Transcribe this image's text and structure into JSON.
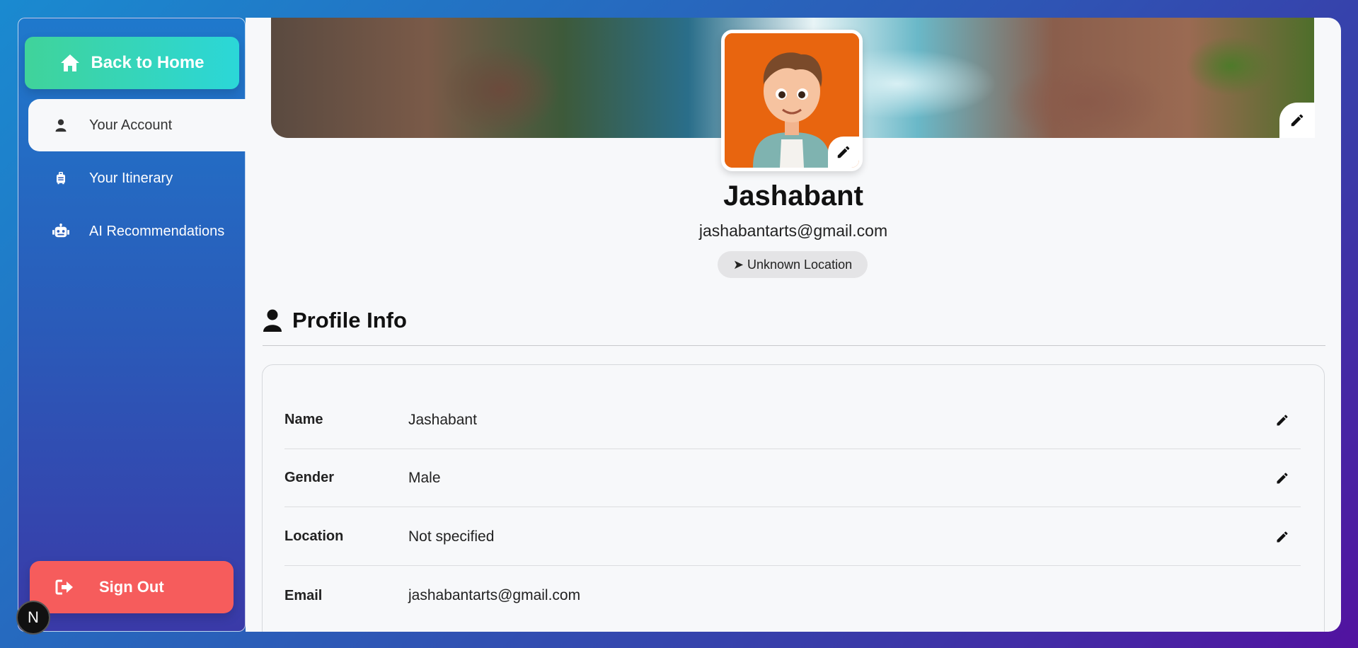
{
  "sidebar": {
    "back_home_label": "Back to Home",
    "items": [
      {
        "label": "Your Account",
        "icon": "user-icon",
        "active": true
      },
      {
        "label": "Your Itinerary",
        "icon": "luggage-icon",
        "active": false
      },
      {
        "label": "AI Recommendations",
        "icon": "robot-icon",
        "active": false
      }
    ],
    "sign_out_label": "Sign Out",
    "badge_letter": "N"
  },
  "profile": {
    "name": "Jashabant",
    "email": "jashabantarts@gmail.com",
    "location_badge": "➤ Unknown Location"
  },
  "profile_info": {
    "title": "Profile Info",
    "rows": [
      {
        "label": "Name",
        "value": "Jashabant",
        "editable": true
      },
      {
        "label": "Gender",
        "value": "Male",
        "editable": true
      },
      {
        "label": "Location",
        "value": "Not specified",
        "editable": true
      },
      {
        "label": "Email",
        "value": "jashabantarts@gmail.com",
        "editable": false
      }
    ]
  },
  "colors": {
    "accent_green": "#40d39a",
    "accent_cyan": "#2bd7d8",
    "sign_out_red": "#f65c5c",
    "avatar_bg": "#e8650f"
  }
}
